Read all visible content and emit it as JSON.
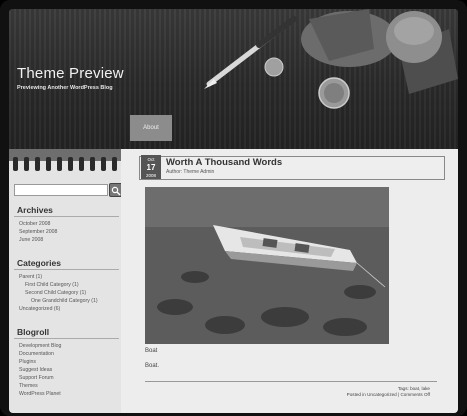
{
  "site": {
    "title": "Theme Preview",
    "description": "Previewing Another WordPress Blog"
  },
  "nav": {
    "tabs": [
      {
        "label": "About"
      }
    ]
  },
  "sidebar": {
    "archives": {
      "heading": "Archives",
      "items": [
        "October 2008",
        "September 2008",
        "June 2008"
      ]
    },
    "categories": {
      "heading": "Categories",
      "items": [
        "Parent (1)",
        "First Child Category (1)",
        "Second Child Category (1)",
        "One Grandchild Category (1)",
        "Uncategorized (6)"
      ]
    },
    "blogroll": {
      "heading": "Blogroll",
      "items": [
        "Development Blog",
        "Documentation",
        "Plugins",
        "Suggest Ideas",
        "Support Forum",
        "Themes",
        "WordPress Planet"
      ]
    }
  },
  "post": {
    "date_month": "Oct",
    "date_day": "17",
    "date_year": "2008",
    "title": "Worth A Thousand Words",
    "author": "Author: Theme Admin",
    "caption": "Boat",
    "body": "Boat.",
    "tags": "Tags: boat, lake",
    "posted_in": "Posted in Uncategorized | Comments Off"
  },
  "colors": {
    "header_bg": "#2b2b2b",
    "sidebar_bg": "#e4e4e4",
    "content_bg": "#ededed",
    "nav_tab_bg": "#8c8c8c"
  }
}
